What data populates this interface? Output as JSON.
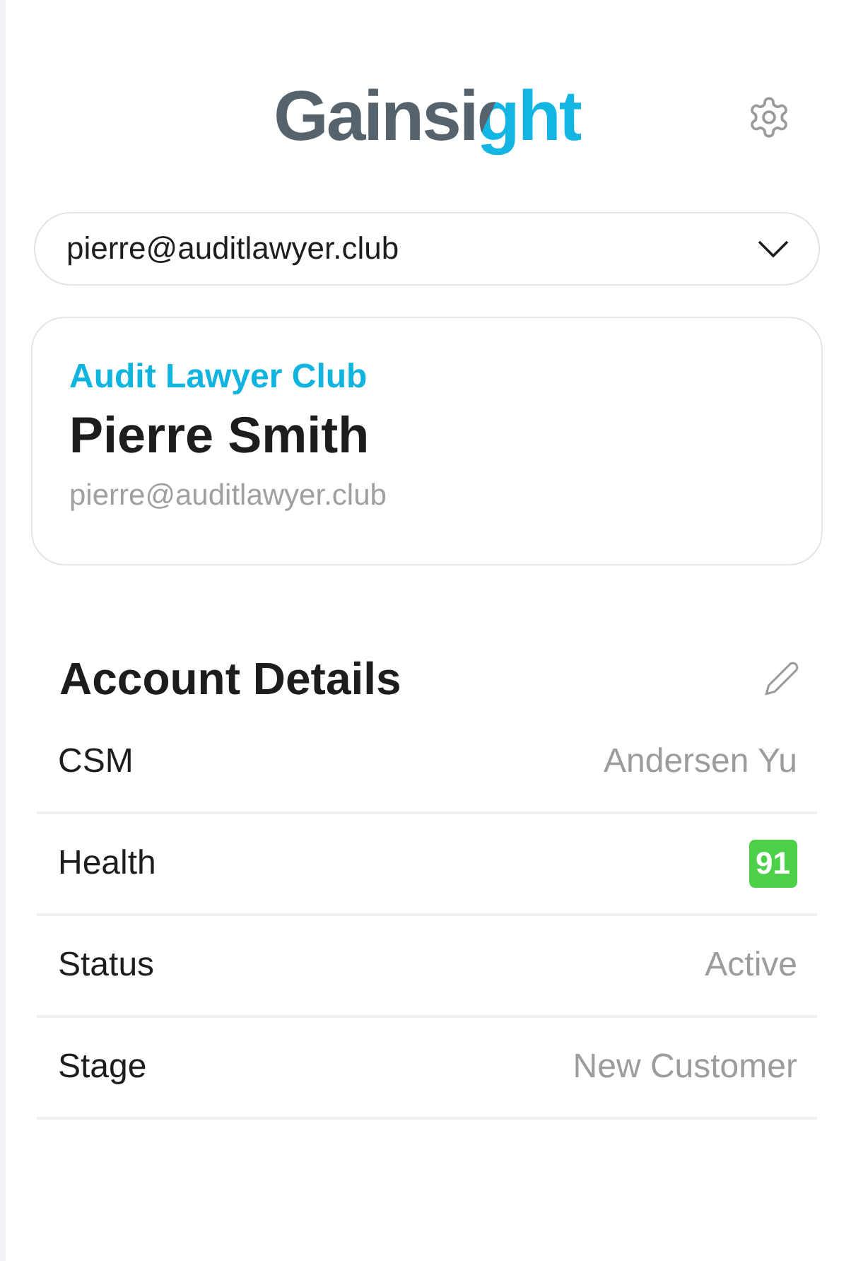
{
  "header": {
    "logo": "Gainsight"
  },
  "account_selector": {
    "value": "pierre@auditlawyer.club"
  },
  "contact_card": {
    "company": "Audit Lawyer Club",
    "name": "Pierre Smith",
    "email": "pierre@auditlawyer.club"
  },
  "account_details": {
    "title": "Account Details",
    "rows": [
      {
        "kind": "text",
        "label": "CSM",
        "value": "Andersen Yu"
      },
      {
        "kind": "badge",
        "label": "Health",
        "value": "91",
        "color": "#4cd04a"
      },
      {
        "kind": "text",
        "label": "Status",
        "value": "Active"
      },
      {
        "kind": "text",
        "label": "Stage",
        "value": "New Customer"
      }
    ]
  }
}
